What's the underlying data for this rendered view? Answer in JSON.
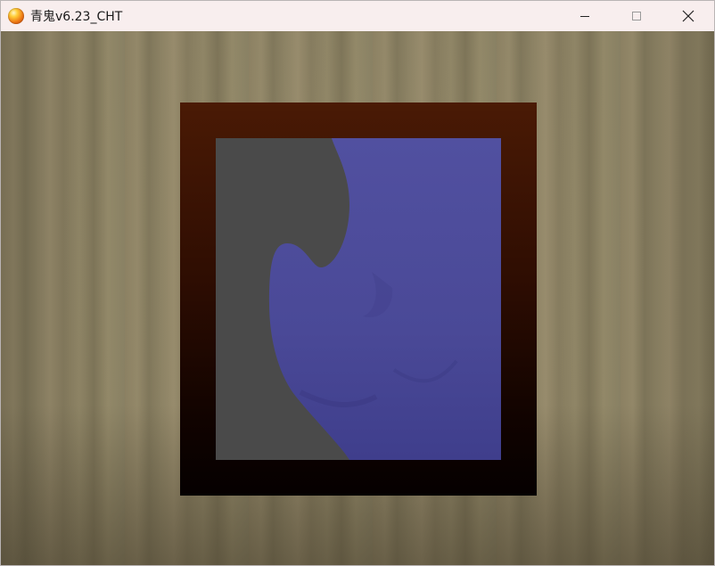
{
  "window": {
    "title": "青鬼v6.23_CHT",
    "app_icon": "orb-icon"
  },
  "controls": {
    "minimize": "minimize-icon",
    "maximize": "maximize-icon",
    "close": "close-icon"
  },
  "scene": {
    "wall_color": "#8a7f63",
    "frame_color_top": "#4a1a05",
    "frame_color_bottom": "#050000",
    "painting_background": "#4a4a4a",
    "painting_figure_color": "#4f4f9f"
  }
}
